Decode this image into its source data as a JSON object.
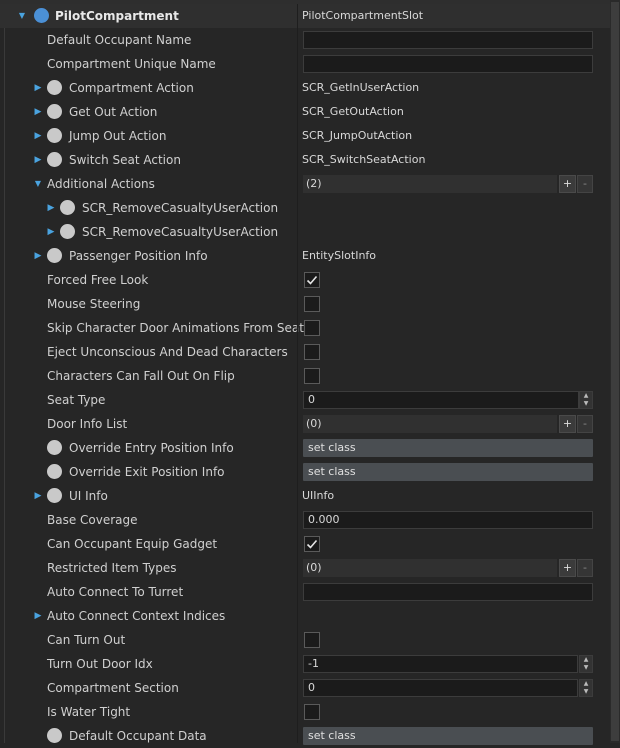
{
  "rows": [
    {
      "id": "pilot-compartment",
      "label": "PilotCompartment",
      "indent": 0,
      "arrow": "down",
      "dot": "blue",
      "header": true,
      "value": {
        "type": "text",
        "text": "PilotCompartmentSlot"
      }
    },
    {
      "id": "default-occupant-name",
      "label": "Default Occupant Name",
      "indent": 1,
      "value": {
        "type": "textbox",
        "text": ""
      }
    },
    {
      "id": "compartment-unique-name",
      "label": "Compartment Unique Name",
      "indent": 1,
      "value": {
        "type": "textbox",
        "text": ""
      }
    },
    {
      "id": "compartment-action",
      "label": "Compartment Action",
      "indent": 1,
      "arrow": "right",
      "dot": "gray",
      "value": {
        "type": "text",
        "text": "SCR_GetInUserAction"
      }
    },
    {
      "id": "get-out-action",
      "label": "Get Out Action",
      "indent": 1,
      "arrow": "right",
      "dot": "gray",
      "value": {
        "type": "text",
        "text": "SCR_GetOutAction"
      }
    },
    {
      "id": "jump-out-action",
      "label": "Jump Out Action",
      "indent": 1,
      "arrow": "right",
      "dot": "gray",
      "value": {
        "type": "text",
        "text": "SCR_JumpOutAction"
      }
    },
    {
      "id": "switch-seat-action",
      "label": "Switch Seat Action",
      "indent": 1,
      "arrow": "right",
      "dot": "gray",
      "value": {
        "type": "text",
        "text": "SCR_SwitchSeatAction"
      }
    },
    {
      "id": "additional-actions",
      "label": "Additional Actions",
      "indent": 1,
      "arrow": "down",
      "value": {
        "type": "array",
        "text": "(2)"
      }
    },
    {
      "id": "remove-casualty-1",
      "label": "SCR_RemoveCasualtyUserAction",
      "indent": 2,
      "arrow": "right",
      "dot": "gray",
      "value": {
        "type": "none"
      }
    },
    {
      "id": "remove-casualty-2",
      "label": "SCR_RemoveCasualtyUserAction",
      "indent": 2,
      "arrow": "right",
      "dot": "gray",
      "value": {
        "type": "none"
      }
    },
    {
      "id": "passenger-position-info",
      "label": "Passenger Position Info",
      "indent": 1,
      "arrow": "right",
      "dot": "gray",
      "value": {
        "type": "text",
        "text": "EntitySlotInfo"
      }
    },
    {
      "id": "forced-free-look",
      "label": "Forced Free Look",
      "indent": 1,
      "value": {
        "type": "checkbox",
        "checked": true
      }
    },
    {
      "id": "mouse-steering",
      "label": "Mouse Steering",
      "indent": 1,
      "value": {
        "type": "checkbox",
        "checked": false
      }
    },
    {
      "id": "skip-door-animations",
      "label": "Skip Character Door Animations From Seat",
      "indent": 1,
      "value": {
        "type": "checkbox",
        "checked": false
      }
    },
    {
      "id": "eject-unconscious",
      "label": "Eject Unconscious And Dead Characters",
      "indent": 1,
      "value": {
        "type": "checkbox",
        "checked": false
      }
    },
    {
      "id": "fall-out-on-flip",
      "label": "Characters Can Fall Out On Flip",
      "indent": 1,
      "value": {
        "type": "checkbox",
        "checked": false
      }
    },
    {
      "id": "seat-type",
      "label": "Seat Type",
      "indent": 1,
      "value": {
        "type": "number",
        "text": "0",
        "wide": true
      }
    },
    {
      "id": "door-info-list",
      "label": "Door Info List",
      "indent": 1,
      "value": {
        "type": "array",
        "text": "(0)"
      }
    },
    {
      "id": "override-entry-position",
      "label": "Override Entry Position Info",
      "indent": 1,
      "dot": "gray",
      "value": {
        "type": "setclass",
        "text": "set class"
      }
    },
    {
      "id": "override-exit-position",
      "label": "Override Exit Position Info",
      "indent": 1,
      "dot": "gray",
      "value": {
        "type": "setclass",
        "text": "set class"
      }
    },
    {
      "id": "ui-info",
      "label": "UI Info",
      "indent": 1,
      "arrow": "right",
      "dot": "gray",
      "value": {
        "type": "text",
        "text": "UIInfo"
      }
    },
    {
      "id": "base-coverage",
      "label": "Base Coverage",
      "indent": 1,
      "value": {
        "type": "textbox",
        "text": "0.000"
      }
    },
    {
      "id": "can-equip-gadget",
      "label": "Can Occupant Equip Gadget",
      "indent": 1,
      "value": {
        "type": "checkbox",
        "checked": true
      }
    },
    {
      "id": "restricted-item-types",
      "label": "Restricted Item Types",
      "indent": 1,
      "value": {
        "type": "array",
        "text": "(0)"
      }
    },
    {
      "id": "auto-connect-turret",
      "label": "Auto Connect To Turret",
      "indent": 1,
      "value": {
        "type": "textbox",
        "text": ""
      }
    },
    {
      "id": "auto-connect-context",
      "label": "Auto Connect Context Indices",
      "indent": 1,
      "arrow": "right",
      "value": {
        "type": "none"
      }
    },
    {
      "id": "can-turn-out",
      "label": "Can Turn Out",
      "indent": 1,
      "value": {
        "type": "checkbox",
        "checked": false
      }
    },
    {
      "id": "turn-out-door-idx",
      "label": "Turn Out Door Idx",
      "indent": 1,
      "value": {
        "type": "number",
        "text": "-1"
      }
    },
    {
      "id": "compartment-section",
      "label": "Compartment Section",
      "indent": 1,
      "value": {
        "type": "number",
        "text": "0"
      }
    },
    {
      "id": "is-water-tight",
      "label": "Is Water Tight",
      "indent": 1,
      "value": {
        "type": "checkbox",
        "checked": false
      }
    },
    {
      "id": "default-occupant-data",
      "label": "Default Occupant Data",
      "indent": 1,
      "dot": "gray",
      "value": {
        "type": "setclass",
        "text": "set class"
      }
    }
  ],
  "buttons": {
    "add": "+",
    "remove": "-"
  },
  "colors": {
    "accent": "#4aa3df",
    "dot_blue": "#4b90d6",
    "dot_gray": "#c9c9c9",
    "background": "#262626"
  }
}
